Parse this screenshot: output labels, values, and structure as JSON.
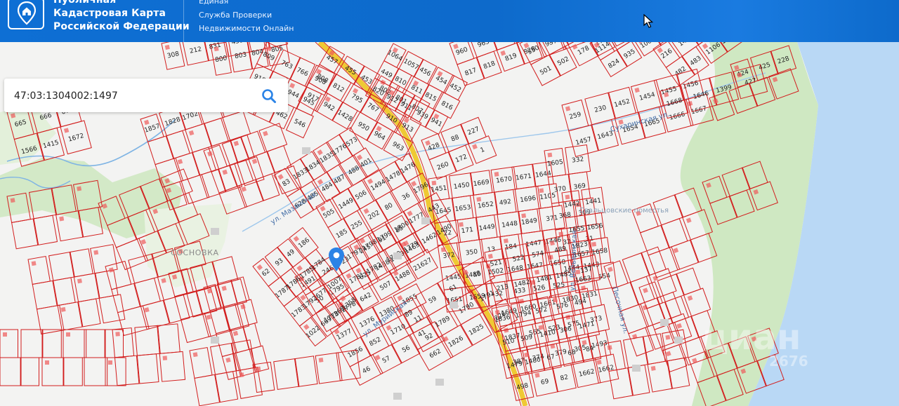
{
  "header": {
    "brand_line1": "Публичная",
    "brand_line2": "Кадастровая Карта",
    "brand_line3": "Российской Федерации",
    "service_line1": "Единая",
    "service_line2": "Служба Проверки",
    "service_line3": "Недвижимости Онлайн"
  },
  "search": {
    "value": "47:03:1304002:1497"
  },
  "map": {
    "streets": [
      "ул. Мазанская",
      "Сухаринская ул.",
      "ул. Вельвинская",
      "Песочная ул.",
      "ул. Мурийская"
    ],
    "place_labels": [
      "СОСНОВКА",
      "Свальцовские поместья"
    ],
    "watermark": "циан",
    "watermark_id": "2676",
    "parcels": [
      "308",
      "212",
      "831",
      "459",
      "857",
      "799",
      "800",
      "803",
      "804",
      "805",
      "809",
      "763",
      "766",
      "908",
      "918",
      "919",
      "944",
      "945",
      "136",
      "484",
      "462",
      "546",
      "457",
      "455",
      "453",
      "802",
      "801",
      "807",
      "808",
      "812",
      "795",
      "767",
      "910",
      "913",
      "917",
      "942",
      "1428",
      "950",
      "964",
      "963",
      "1064",
      "1057",
      "456",
      "454",
      "452",
      "449",
      "810",
      "811",
      "815",
      "816",
      "820",
      "912",
      "911",
      "939",
      "941",
      "960",
      "965",
      "503",
      "475",
      "477",
      "479",
      "448",
      "813",
      "817",
      "818",
      "819",
      "828",
      "937",
      "938",
      "1068",
      "551",
      "550",
      "512",
      "511",
      "951",
      "1107",
      "422",
      "501",
      "502",
      "178",
      "177",
      "217",
      "218",
      "1114",
      "565",
      "450",
      "447",
      "821",
      "824",
      "935",
      "1069",
      "419",
      "418",
      "216",
      "142",
      "564",
      "481",
      "482",
      "483",
      "1106",
      "1398",
      "424",
      "425",
      "228",
      "259",
      "230",
      "1452",
      "1454",
      "1455",
      "1456",
      "1457",
      "1643",
      "1654",
      "1665",
      "1666",
      "1667",
      "1668",
      "1646",
      "1399",
      "427",
      "428",
      "88",
      "227",
      "260",
      "172",
      "1",
      "1451",
      "1450",
      "1669",
      "1670",
      "1671",
      "1644",
      "1645",
      "1653",
      "1652",
      "492",
      "1696",
      "1105",
      "22",
      "171",
      "1449",
      "1448",
      "1849",
      "371",
      "372",
      "350",
      "13",
      "184",
      "1447",
      "1446",
      "1445",
      "1486",
      "1502",
      "1648",
      "1647",
      "1650",
      "1651",
      "1659",
      "432",
      "433",
      "526",
      "525",
      "1605",
      "332",
      "370",
      "369",
      "368",
      "309",
      "32",
      "31",
      "1444",
      "1443",
      "1442",
      "1441",
      "1655",
      "1656",
      "1657",
      "1658",
      "1663",
      "554",
      "521",
      "522",
      "574",
      "489",
      "1823",
      "213",
      "1482",
      "1481",
      "1485",
      "137",
      "1649",
      "1660",
      "1661",
      "1830",
      "1831",
      "1837",
      "565",
      "523",
      "575",
      "373",
      "387",
      "374",
      "379",
      "305",
      "1493",
      "498",
      "69",
      "82",
      "1662",
      "1662",
      "1836",
      "1794",
      "572",
      "576",
      "494",
      "510",
      "509",
      "1410",
      "306",
      "1471",
      "1479",
      "1480",
      "67",
      "68",
      "84",
      "83",
      "1833",
      "1834",
      "1835",
      "1776",
      "573",
      "628",
      "485",
      "484",
      "487",
      "488",
      "401",
      "505",
      "1449",
      "506",
      "1494",
      "1478",
      "1476",
      "185",
      "255",
      "202",
      "80",
      "36",
      "1796",
      "1797",
      "1798",
      "1799",
      "1800",
      "1777",
      "443",
      "625",
      "1438",
      "1439",
      "1463",
      "1462",
      "1490",
      "1491",
      "246",
      "23",
      "245",
      "91",
      "85",
      "50",
      "1795",
      "1781",
      "1782",
      "1780",
      "1779",
      "1778",
      "1778",
      "642",
      "507",
      "1488",
      "21627",
      "62",
      "93",
      "49",
      "186",
      "1787",
      "1786",
      "1785",
      "1784",
      "1783",
      "1792",
      "677",
      "1007",
      "1022",
      "669",
      "1360",
      "1358",
      "1377",
      "1376",
      "1380",
      "1855",
      "1856",
      "852",
      "1710",
      "11",
      "46",
      "57",
      "56",
      "92",
      "89",
      "59",
      "61",
      "48",
      "41",
      "1789",
      "1790",
      "1791",
      "662",
      "1826",
      "1825",
      "226",
      "665",
      "666",
      "670",
      "1566",
      "1415",
      "1672",
      "1857",
      "1828",
      "1702",
      "73",
      "667"
    ]
  },
  "colors": {
    "header_bg": "#0d6fd1",
    "parcel_stroke": "#d21d1d",
    "road_yellow": "#f2cc28",
    "water": "#b9d8f5",
    "green": "#cde7c0",
    "marker": "#2b83e6"
  }
}
